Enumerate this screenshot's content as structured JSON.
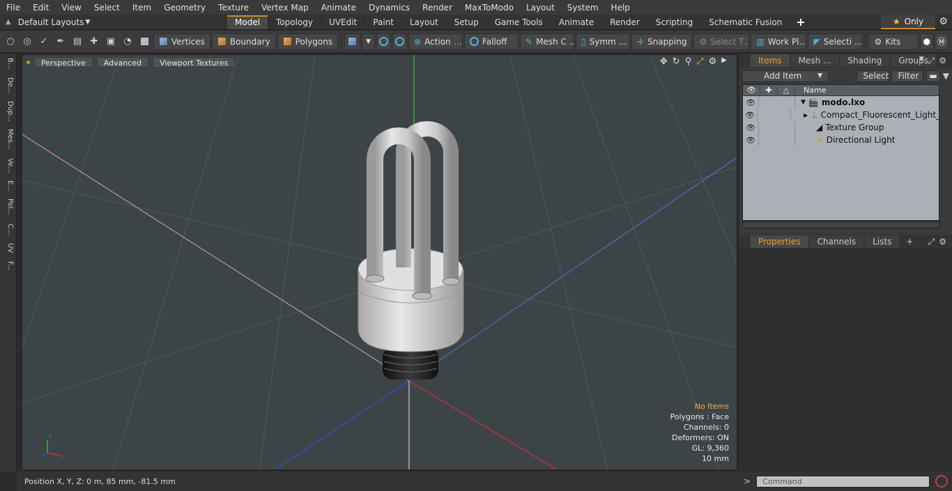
{
  "menu": [
    "File",
    "Edit",
    "View",
    "Select",
    "Item",
    "Geometry",
    "Texture",
    "Vertex Map",
    "Animate",
    "Dynamics",
    "Render",
    "MaxToModo",
    "Layout",
    "System",
    "Help"
  ],
  "layout_selector": "Default Layouts",
  "tabs": [
    "Model",
    "Topology",
    "UVEdit",
    "Paint",
    "Layout",
    "Setup",
    "Game Tools",
    "Animate",
    "Render",
    "Scripting",
    "Schematic Fusion"
  ],
  "active_tab": "Model",
  "only_label": "Only",
  "toolbar": {
    "vertices": "Vertices",
    "boundary": "Boundary",
    "polygons": "Polygons",
    "action": "Action",
    "falloff": "Falloff",
    "mesh": "Mesh C ...",
    "symm": "Symm ...",
    "snapping": "Snapping",
    "select_t": "Select T...",
    "work_pl": "Work Pl...",
    "selecti": "Selecti ...",
    "kits": "Kits"
  },
  "left_strip": [
    "B...",
    "De...",
    "Dup...",
    "Mes...",
    "Ve...",
    "E...",
    "Pol...",
    "C...",
    "UV",
    "F..."
  ],
  "viewport": {
    "perspective": "Perspective",
    "advanced": "Advanced",
    "viewport_textures": "Viewport Textures",
    "stats": {
      "no_items": "No Items",
      "polygons": "Polygons : Face",
      "channels": "Channels: 0",
      "deformers": "Deformers: ON",
      "gl": "GL: 9,360",
      "scale": "10 mm"
    },
    "gizmo": {
      "y": "Y",
      "x": "X",
      "z": "Z"
    }
  },
  "status": {
    "position": "Position X, Y, Z:   0 m, 85 mm, -81.5 mm"
  },
  "items_panel": {
    "tabs": [
      "Items",
      "Mesh ...",
      "Shading",
      "Groups"
    ],
    "active_tab": "Items",
    "add_item": "Add Item",
    "select": "Select",
    "filter": "Filter",
    "header_name": "Name",
    "rows": [
      {
        "name": "modo.lxo",
        "bold": true
      },
      {
        "name": "Compact_Fluorescent_Light_ ..."
      },
      {
        "name": "Texture Group"
      },
      {
        "name": "Directional Light"
      }
    ]
  },
  "props_panel": {
    "tabs": [
      "Properties",
      "Channels",
      "Lists"
    ],
    "active_tab": "Properties"
  },
  "command": {
    "placeholder": "Command"
  },
  "colors": {
    "accent": "#d28e29",
    "viewport_bg": "#3d4448",
    "axis_y": "#2fc02f",
    "axis_x": "#d03030",
    "axis_z": "#3050d0"
  }
}
